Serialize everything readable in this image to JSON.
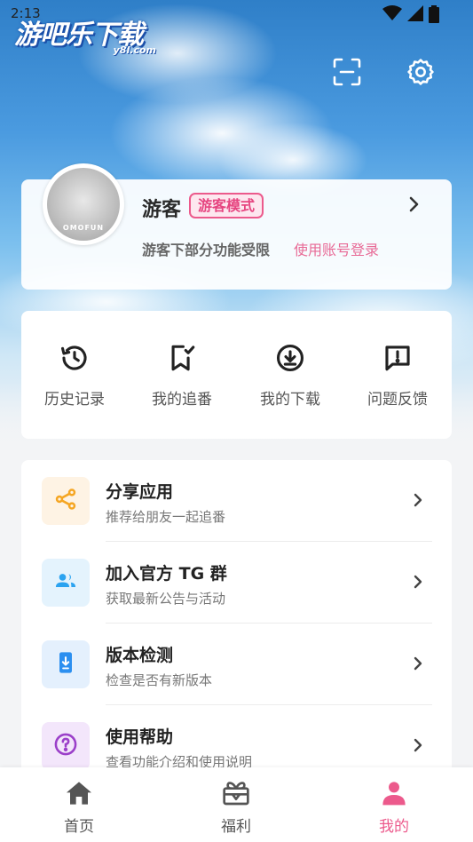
{
  "status_bar": {
    "time": "2:13"
  },
  "logo": {
    "text": "游吧乐下载",
    "sub": "y8l.com"
  },
  "profile": {
    "name": "游客",
    "badge": "游客模式",
    "limit_text": "游客下部分功能受限",
    "login_link": "使用账号登录",
    "avatar_brand": "OMOFUN"
  },
  "quick_actions": [
    {
      "label": "历史记录",
      "icon": "history-icon"
    },
    {
      "label": "我的追番",
      "icon": "bookmark-check-icon"
    },
    {
      "label": "我的下载",
      "icon": "download-icon"
    },
    {
      "label": "问题反馈",
      "icon": "feedback-icon"
    }
  ],
  "menu": [
    {
      "title": "分享应用",
      "subtitle": "推荐给朋友一起追番",
      "icon": "share-icon",
      "color": "#f5a623",
      "bg": "#fef3e4"
    },
    {
      "title": "加入官方 TG 群",
      "subtitle": "获取最新公告与活动",
      "icon": "group-icon",
      "color": "#2ba3f0",
      "bg": "#e4f3fd"
    },
    {
      "title": "版本检测",
      "subtitle": "检查是否有新版本",
      "icon": "phone-update-icon",
      "color": "#2b8ff0",
      "bg": "#e4f0fd"
    },
    {
      "title": "使用帮助",
      "subtitle": "查看功能介绍和使用说明",
      "icon": "help-icon",
      "color": "#9b3fc9",
      "bg": "#f3e6fb"
    }
  ],
  "bottom_nav": [
    {
      "label": "首页",
      "icon": "home-icon"
    },
    {
      "label": "福利",
      "icon": "gift-icon"
    },
    {
      "label": "我的",
      "icon": "user-icon",
      "active": true
    }
  ],
  "colors": {
    "accent": "#ec5a8c"
  }
}
